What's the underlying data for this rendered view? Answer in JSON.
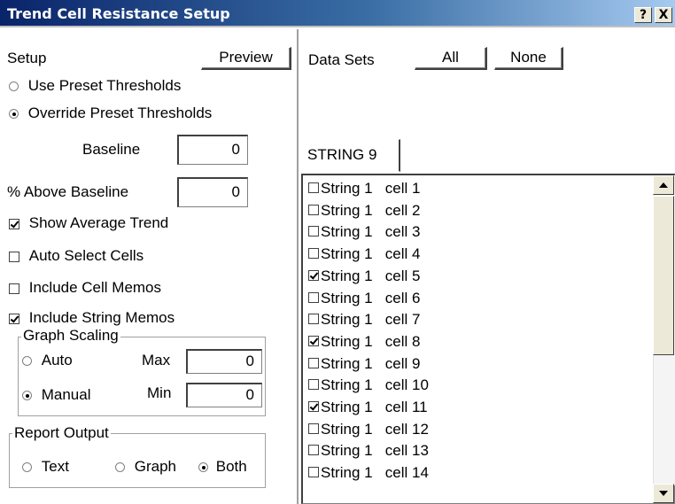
{
  "window": {
    "title": "Trend Cell Resistance Setup",
    "help_label": "?",
    "close_label": "X"
  },
  "setup": {
    "heading": "Setup",
    "preview_label": "Preview",
    "use_preset_label": "Use Preset Thresholds",
    "use_preset_selected": false,
    "override_preset_label": "Override Preset Thresholds",
    "override_preset_selected": true,
    "baseline_label": "Baseline",
    "baseline_value": "0",
    "above_baseline_label": "% Above Baseline",
    "above_baseline_value": "0",
    "show_average_label": "Show Average Trend",
    "show_average_checked": true,
    "auto_select_label": "Auto Select Cells",
    "auto_select_checked": false,
    "cell_memos_label": "Include Cell Memos",
    "cell_memos_checked": false,
    "string_memos_label": "Include String Memos",
    "string_memos_checked": true
  },
  "graph_scaling": {
    "legend": "Graph Scaling",
    "auto_label": "Auto",
    "auto_selected": false,
    "manual_label": "Manual",
    "manual_selected": true,
    "max_label": "Max",
    "max_value": "0",
    "min_label": "Min",
    "min_value": "0"
  },
  "report_output": {
    "legend": "Report Output",
    "text_label": "Text",
    "graph_label": "Graph",
    "both_label": "Both",
    "selected": "Both"
  },
  "data_sets": {
    "heading": "Data Sets",
    "all_label": "All",
    "none_label": "None",
    "tab_label": "STRING 9",
    "items": [
      {
        "label": "String 1   cell 1",
        "checked": false
      },
      {
        "label": "String 1   cell 2",
        "checked": false
      },
      {
        "label": "String 1   cell 3",
        "checked": false
      },
      {
        "label": "String 1   cell 4",
        "checked": false
      },
      {
        "label": "String 1   cell 5",
        "checked": true
      },
      {
        "label": "String 1   cell 6",
        "checked": false
      },
      {
        "label": "String 1   cell 7",
        "checked": false
      },
      {
        "label": "String 1   cell 8",
        "checked": true
      },
      {
        "label": "String 1   cell 9",
        "checked": false
      },
      {
        "label": "String 1   cell 10",
        "checked": false
      },
      {
        "label": "String 1   cell 11",
        "checked": true
      },
      {
        "label": "String 1   cell 12",
        "checked": false
      },
      {
        "label": "String 1   cell 13",
        "checked": false
      },
      {
        "label": "String 1   cell 14",
        "checked": false
      }
    ]
  },
  "colors": {
    "titlebar_start": "#0a246a",
    "titlebar_end": "#a6caf0",
    "background": "#ffffff"
  }
}
